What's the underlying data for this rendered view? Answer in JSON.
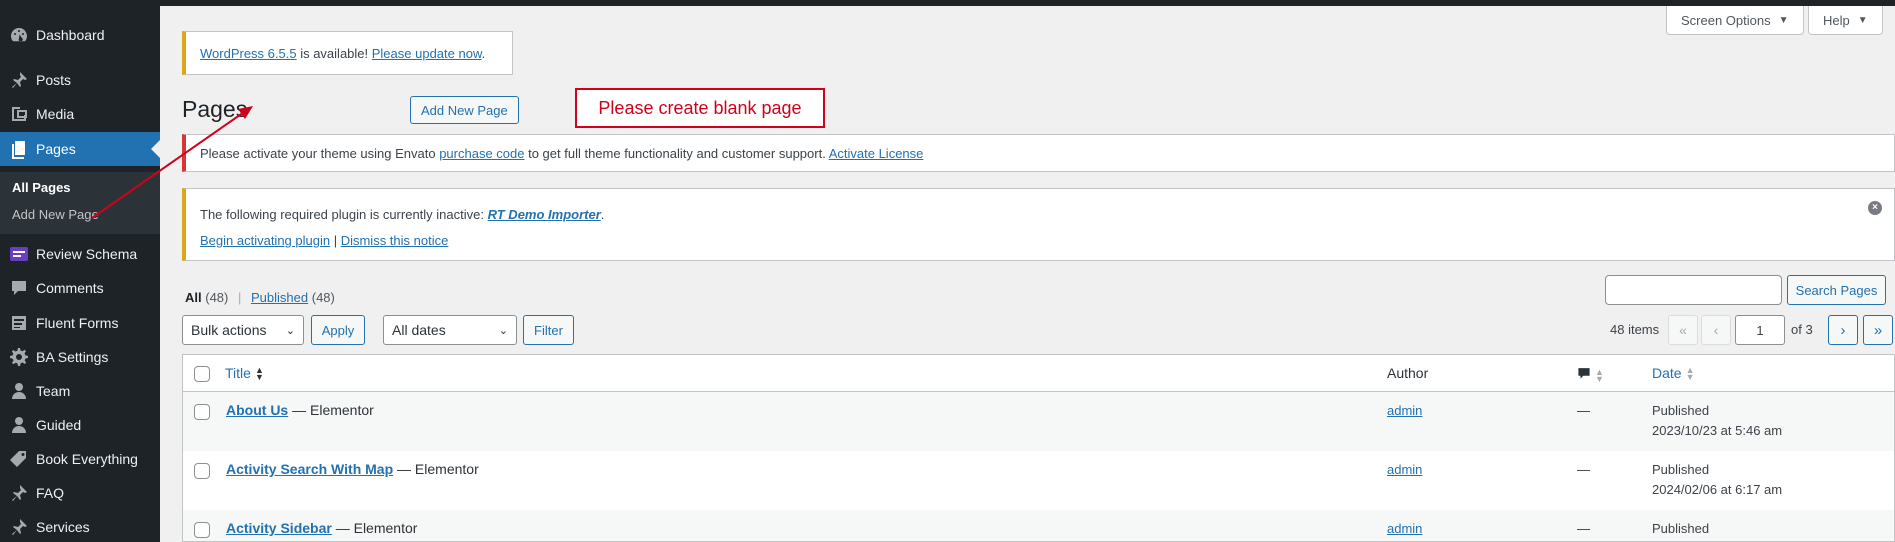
{
  "sidebar": {
    "items": [
      {
        "label": "Dashboard",
        "icon": "dashboard-icon"
      },
      {
        "label": "Posts",
        "icon": "pin-icon"
      },
      {
        "label": "Media",
        "icon": "media-icon"
      },
      {
        "label": "Pages",
        "icon": "pages-icon",
        "active": true
      },
      {
        "label": "Review Schema",
        "icon": "review-schema-icon"
      },
      {
        "label": "Comments",
        "icon": "comment-icon"
      },
      {
        "label": "Fluent Forms",
        "icon": "forms-icon"
      },
      {
        "label": "BA Settings",
        "icon": "gear-icon"
      },
      {
        "label": "Team",
        "icon": "person-icon"
      },
      {
        "label": "Guided",
        "icon": "person-icon"
      },
      {
        "label": "Book Everything",
        "icon": "tag-icon"
      },
      {
        "label": "FAQ",
        "icon": "pin-icon"
      },
      {
        "label": "Services",
        "icon": "pin-icon"
      }
    ],
    "submenu": [
      {
        "label": "All Pages",
        "current": true
      },
      {
        "label": "Add New Page"
      }
    ]
  },
  "header": {
    "screen_options": "Screen Options",
    "help": "Help"
  },
  "update_notice": {
    "version_link": "WordPress 6.5.5",
    "middle": " is available! ",
    "update_link": "Please update now",
    "tail": "."
  },
  "page": {
    "title": "Pages",
    "add_new": "Add New Page"
  },
  "annotation": {
    "text": "Please create blank page",
    "color": "#d0021b"
  },
  "envato_notice": {
    "text1": "Please activate your theme using Envato ",
    "link1": "purchase code",
    "text2": " to get full theme functionality and customer support. ",
    "link2": "Activate License"
  },
  "plugin_notice": {
    "text": "The following required plugin is currently inactive: ",
    "plugin_link": "RT Demo Importer",
    "tail": ".",
    "activate_link": "Begin activating plugin",
    "separator": " | ",
    "dismiss_link": "Dismiss this notice",
    "dismiss_icon": "close-circle-icon"
  },
  "filters": {
    "all_label": "All",
    "all_count": "(48)",
    "separator": "|",
    "published_label": "Published",
    "published_count": "(48)",
    "bulk_actions": "Bulk actions",
    "apply": "Apply",
    "dates": "All dates",
    "filter": "Filter",
    "search_button": "Search Pages",
    "search_value": ""
  },
  "pagination": {
    "items": "48 items",
    "first": "«",
    "prev": "‹",
    "current": "1",
    "of": "of 3",
    "next": "›",
    "last": "»"
  },
  "table": {
    "columns": {
      "title": "Title",
      "author": "Author",
      "comments_icon": "comment-bubble-icon",
      "date": "Date"
    },
    "rows": [
      {
        "title": "About Us",
        "suffix": " — Elementor",
        "author": "admin",
        "comments": "—",
        "status": "Published",
        "date": "2023/10/23 at 5:46 am"
      },
      {
        "title": "Activity Search With Map",
        "suffix": " — Elementor",
        "author": "admin",
        "comments": "—",
        "status": "Published",
        "date": "2024/02/06 at 6:17 am"
      },
      {
        "title": "Activity Sidebar",
        "suffix": " — Elementor",
        "author": "admin",
        "comments": "—",
        "status": "Published",
        "date": ""
      }
    ]
  },
  "colors": {
    "sidebar_bg": "#1d2327",
    "accent": "#2271b1",
    "warning": "#dba617",
    "error": "#d63638"
  }
}
